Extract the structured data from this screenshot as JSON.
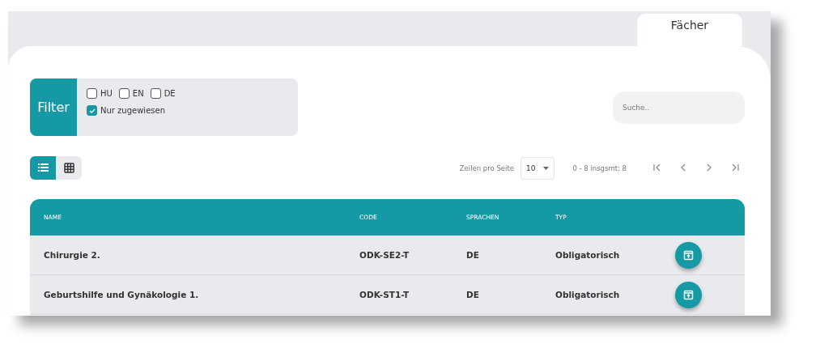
{
  "tabs": [
    {
      "label": "Fächer",
      "selected": true
    }
  ],
  "filter": {
    "label": "Filter",
    "options": [
      {
        "label": "HU",
        "checked": false
      },
      {
        "label": "EN",
        "checked": false
      },
      {
        "label": "DE",
        "checked": false
      }
    ],
    "assigned": {
      "label": "Nur zugewiesen",
      "checked": true
    }
  },
  "search": {
    "placeholder": "Suche.."
  },
  "views": [
    {
      "kind": "list",
      "selected": true
    },
    {
      "kind": "grid",
      "selected": false
    }
  ],
  "pagination": {
    "rows_label": "Zeilen pro Seite",
    "rows_value": "10",
    "range": "0 - 8 insgsmt: 8"
  },
  "table": {
    "columns": [
      "NAME",
      "CODE",
      "SPRACHEN",
      "TYP"
    ],
    "rows": [
      {
        "name": "Chirurgie 2.",
        "code": "ODK-SE2-T",
        "languages": "DE",
        "type": "Obligatorisch"
      },
      {
        "name": "Geburtshilfe und Gynäkologie 1.",
        "code": "ODK-ST1-T",
        "languages": "DE",
        "type": "Obligatorisch"
      }
    ]
  }
}
